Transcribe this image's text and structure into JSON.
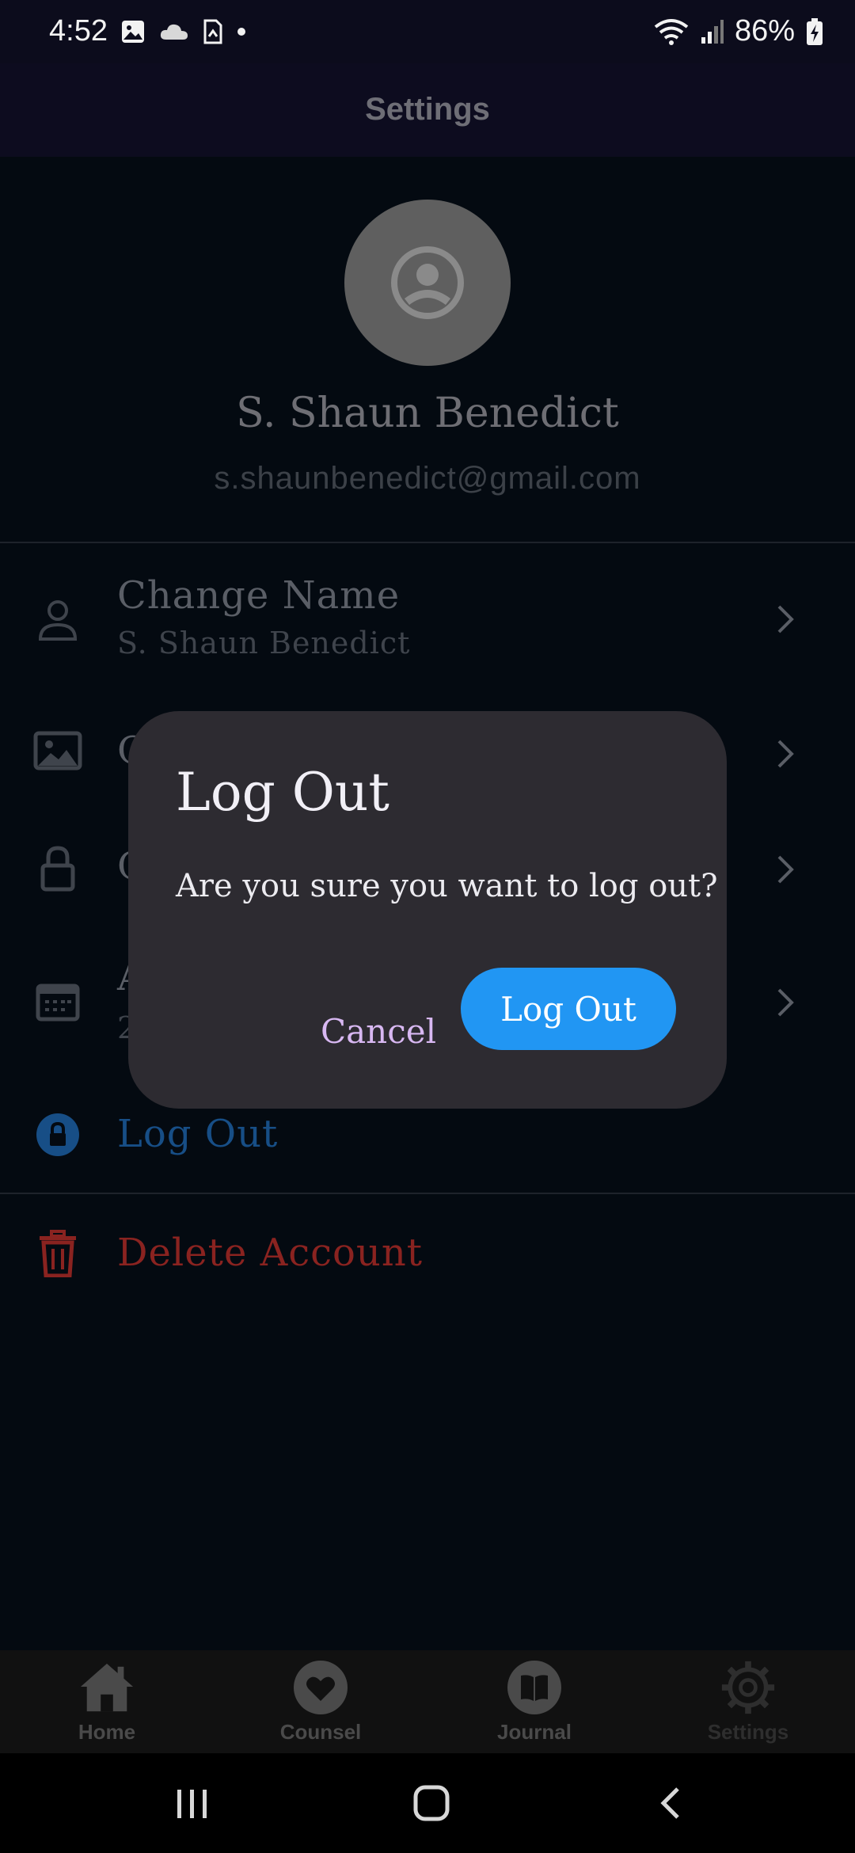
{
  "status_bar": {
    "time": "4:52",
    "battery": "86%"
  },
  "app_bar": {
    "title": "Settings"
  },
  "profile": {
    "name": "S. Shaun Benedict",
    "email": "s.shaunbenedict@gmail.com"
  },
  "settings": {
    "change_name": {
      "title": "Change Name",
      "subtitle": "S. Shaun Benedict"
    },
    "row2": {
      "title": "C"
    },
    "row3": {
      "title": "C"
    },
    "row4": {
      "title": "A",
      "subtitle": "2"
    },
    "logout": {
      "label": "Log Out"
    },
    "delete": {
      "label": "Delete Account"
    }
  },
  "bottom_nav": {
    "items": [
      {
        "label": "Home"
      },
      {
        "label": "Counsel"
      },
      {
        "label": "Journal"
      },
      {
        "label": "Settings"
      }
    ]
  },
  "dialog": {
    "title": "Log Out",
    "message": "Are you sure you want to log out?",
    "cancel": "Cancel",
    "confirm": "Log Out"
  },
  "colors": {
    "accent": "#2196f3",
    "danger": "#8a2320",
    "dialog_bg": "#2d2b31"
  }
}
